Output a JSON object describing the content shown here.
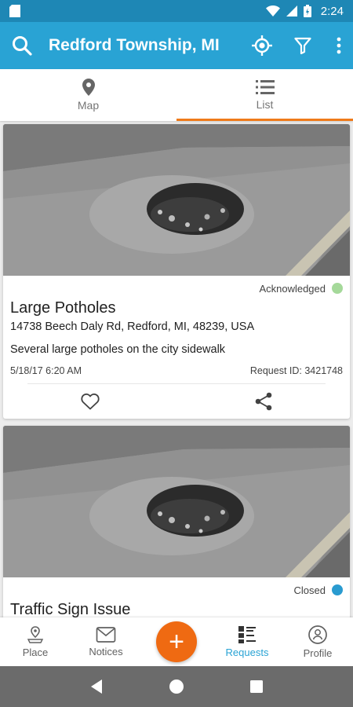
{
  "status_bar": {
    "time": "2:24"
  },
  "app_bar": {
    "title": "Redford Township, MI"
  },
  "tabs": [
    {
      "label": "Map",
      "icon": "map-pin-icon",
      "active": false
    },
    {
      "label": "List",
      "icon": "list-icon",
      "active": true
    }
  ],
  "requests": [
    {
      "status": "Acknowledged",
      "status_color": "#a5d99a",
      "title": "Large Potholes",
      "address": "14738 Beech Daly Rd, Redford, MI, 48239, USA",
      "description": "Several large potholes on the city sidewalk",
      "datetime": "5/18/17 6:20 AM",
      "request_id": "Request ID: 3421748"
    },
    {
      "status": "Closed",
      "status_color": "#2a9bd0",
      "title": "Traffic Sign Issue"
    }
  ],
  "bottom_nav": {
    "place": "Place",
    "notices": "Notices",
    "add": "+",
    "requests": "Requests",
    "profile": "Profile"
  },
  "colors": {
    "primary": "#29a3d4",
    "accent": "#ef7a1a",
    "status_bar": "#1e87b5"
  }
}
